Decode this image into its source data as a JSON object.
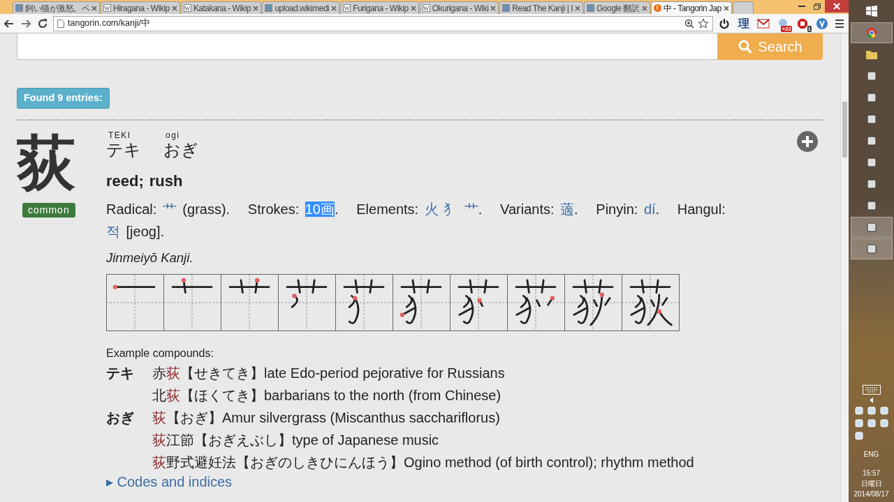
{
  "browser": {
    "tabs": [
      {
        "title": "飼い猫が激怒。ペ",
        "favicon": {
          "kind": "picture"
        },
        "selected": false
      },
      {
        "title": "Hiragana - Wikip",
        "favicon": {
          "kind": "letter",
          "glyph": "W"
        },
        "selected": false
      },
      {
        "title": "Katakana - Wikip",
        "favicon": {
          "kind": "letter",
          "glyph": "W"
        },
        "selected": false
      },
      {
        "title": "upload.wikimedi",
        "favicon": {
          "kind": "picture"
        },
        "selected": false
      },
      {
        "title": "Furigana - Wikip",
        "favicon": {
          "kind": "letter",
          "glyph": "W"
        },
        "selected": false
      },
      {
        "title": "Okurigana - Wiki",
        "favicon": {
          "kind": "letter",
          "glyph": "W"
        },
        "selected": false
      },
      {
        "title": "Read The Kanji | I",
        "favicon": {
          "kind": "picture"
        },
        "selected": false
      },
      {
        "title": "Google 翻訳",
        "favicon": {
          "kind": "picture"
        },
        "selected": false
      },
      {
        "title": "中 - Tangorin Jap",
        "favicon": {
          "kind": "letter",
          "glyph": "!"
        },
        "selected": true
      }
    ],
    "address": "tangorin.com/kanji/中",
    "extensions": [
      {
        "kind": "power"
      },
      {
        "kind": "text",
        "glyph": "理"
      },
      {
        "kind": "mail"
      },
      {
        "kind": "badge",
        "badge": "+22"
      },
      {
        "kind": "stop",
        "badge": "1"
      },
      {
        "kind": "circle"
      }
    ]
  },
  "page": {
    "search_button": "Search",
    "found": "Found 9 entries:",
    "entry": {
      "kanji": "荻",
      "tag": "common",
      "readings": [
        {
          "romaji": "TEKI",
          "kana": "テキ"
        },
        {
          "romaji": "ogi",
          "kana": "おぎ"
        }
      ],
      "meanings": [
        "reed;",
        "rush"
      ],
      "info": [
        {
          "text": "Radical: ",
          "kind": "plain"
        },
        {
          "text": "艹",
          "kind": "link"
        },
        {
          "text": " (grass).   Strokes: ",
          "kind": "plain"
        },
        {
          "text": "10画",
          "kind": "selected"
        },
        {
          "text": ".   Elements: ",
          "kind": "plain"
        },
        {
          "text": "火 犭 艹",
          "kind": "link"
        },
        {
          "text": ".   Variants: ",
          "kind": "plain"
        },
        {
          "text": "藡",
          "kind": "link"
        },
        {
          "text": ".   Pinyin: ",
          "kind": "plain"
        },
        {
          "text": "dí",
          "kind": "link"
        },
        {
          "text": ".   Hangul: ",
          "kind": "plain"
        },
        {
          "text": "적",
          "kind": "link"
        },
        {
          "text": " [jeog].",
          "kind": "plain"
        }
      ],
      "grade": "Jinmeiyō Kanji.",
      "examples_title": "Example compounds:",
      "examples": [
        {
          "reading": "テキ",
          "items": [
            {
              "parts": [
                {
                  "text": "赤",
                  "headword": false
                },
                {
                  "text": "荻",
                  "headword": true
                }
              ],
              "kana": "【せきてき】",
              "gloss": "late Edo-period pejorative for Russians"
            },
            {
              "parts": [
                {
                  "text": "北",
                  "headword": false
                },
                {
                  "text": "荻",
                  "headword": true
                }
              ],
              "kana": "【ほくてき】",
              "gloss": "barbarians to the north (from Chinese)"
            }
          ]
        },
        {
          "reading": "おぎ",
          "items": [
            {
              "parts": [
                {
                  "text": "荻",
                  "headword": true
                }
              ],
              "kana": "【おぎ】",
              "gloss": "Amur silvergrass (Miscanthus sacchariflorus)"
            },
            {
              "parts": [
                {
                  "text": "荻",
                  "headword": true
                },
                {
                  "text": "江節",
                  "headword": false
                }
              ],
              "kana": "【おぎえぶし】",
              "gloss": "type of Japanese music"
            },
            {
              "parts": [
                {
                  "text": "荻",
                  "headword": true
                },
                {
                  "text": "野式避妊法",
                  "headword": false
                }
              ],
              "kana": "【おぎのしきひにんほう】",
              "gloss": "Ogino method (of birth control); rhythm method"
            }
          ]
        }
      ],
      "more_link": "▸ Codes and indices"
    }
  },
  "taskbar": {
    "apps": [
      {
        "kind": "chrome",
        "highlighted": true
      },
      {
        "kind": "folder",
        "highlighted": false
      },
      {
        "kind": "generic",
        "highlighted": false
      },
      {
        "kind": "generic",
        "highlighted": false
      },
      {
        "kind": "generic",
        "highlighted": false
      },
      {
        "kind": "generic",
        "highlighted": false
      },
      {
        "kind": "generic",
        "highlighted": false
      },
      {
        "kind": "generic",
        "highlighted": false
      },
      {
        "kind": "generic",
        "highlighted": false
      },
      {
        "kind": "generic",
        "highlighted": true
      },
      {
        "kind": "generic",
        "highlighted": true
      }
    ],
    "language": "ENG",
    "time": "15:57",
    "day": "日曜日",
    "date": "2014/08/17"
  }
}
